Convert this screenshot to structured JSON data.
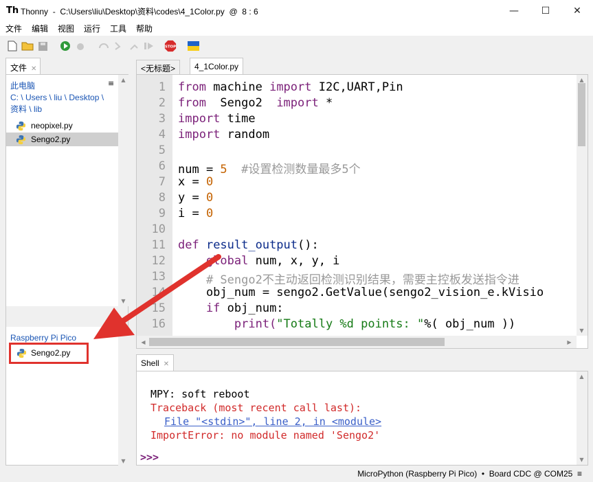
{
  "window": {
    "title": "Thonny  -  C:\\Users\\liu\\Desktop\\资料\\codes\\4_1Color.py  @  8 : 6",
    "app_icon": "Th"
  },
  "menu": [
    "文件",
    "编辑",
    "视图",
    "运行",
    "工具",
    "帮助"
  ],
  "toolbar": {
    "stop_label": "STOP"
  },
  "files_pane": {
    "tab_label": "文件",
    "local_title": "此电脑",
    "local_path": "C: \\ Users \\ liu \\ Desktop \\ 资料 \\ lib",
    "local_files": [
      {
        "name": "neopixel.py",
        "selected": false
      },
      {
        "name": "Sengo2.py",
        "selected": true
      }
    ],
    "remote_title": "Raspberry Pi Pico",
    "remote_files": [
      {
        "name": "Sengo2.py"
      }
    ]
  },
  "editor": {
    "tabs": [
      {
        "label": "<无标题>",
        "active": false
      },
      {
        "label": "4_1Color.py",
        "active": true
      }
    ],
    "line_numbers": [
      "1",
      "2",
      "3",
      "4",
      "5",
      "6",
      "7",
      "8",
      "9",
      "10",
      "11",
      "12",
      "13",
      "14",
      "15",
      "16"
    ],
    "code": {
      "l1_kw1": "from",
      "l1_mid": " machine ",
      "l1_kw2": "import",
      "l1_rest": " I2C,UART,Pin",
      "l2_kw1": "from",
      "l2_mid": "  Sengo2  ",
      "l2_kw2": "import",
      "l2_rest": " *",
      "l3_kw": "import",
      "l3_rest": " time",
      "l4_kw": "import",
      "l4_rest": " random",
      "l6_a": "num = ",
      "l6_num": "5",
      "l6_cmt": "  #设置检测数量最多5个",
      "l7_a": "x = ",
      "l7_num": "0",
      "l8_a": "y = ",
      "l8_num": "0",
      "l9_a": "i = ",
      "l9_num": "0",
      "l11_kw": "def",
      "l11_fn": " result_output",
      "l11_rest": "():",
      "l12_kw": "    global",
      "l12_rest": " num, x, y, i",
      "l13_cmt": "    # Sengo2不主动返回检测识别结果，需要主控板发送指令进",
      "l14": "    obj_num = sengo2.GetValue(sengo2_vision_e.kVisio",
      "l15_kw": "    if",
      "l15_rest": " obj_num:",
      "l16_a": "        print(",
      "l16_str1": "\"Totally %d points: \"",
      "l16_rest": "%( obj_num ))"
    }
  },
  "shell": {
    "tab_label": "Shell",
    "lines": {
      "soft_reboot": "MPY: soft reboot",
      "traceback": "Traceback (most recent call last):",
      "file_link": "File \"<stdin>\", line 2, in <module>",
      "error": "ImportError: no module named 'Sengo2'"
    },
    "prompt": ">>>"
  },
  "statusbar": {
    "text": "MicroPython (Raspberry Pi Pico)  •  Board CDC @ COM25  ≡"
  },
  "colors": {
    "annotation_red": "#e0322d",
    "error_red": "#d12a2a",
    "keyword": "#7a1f78",
    "number": "#c46200",
    "string": "#157a15"
  }
}
